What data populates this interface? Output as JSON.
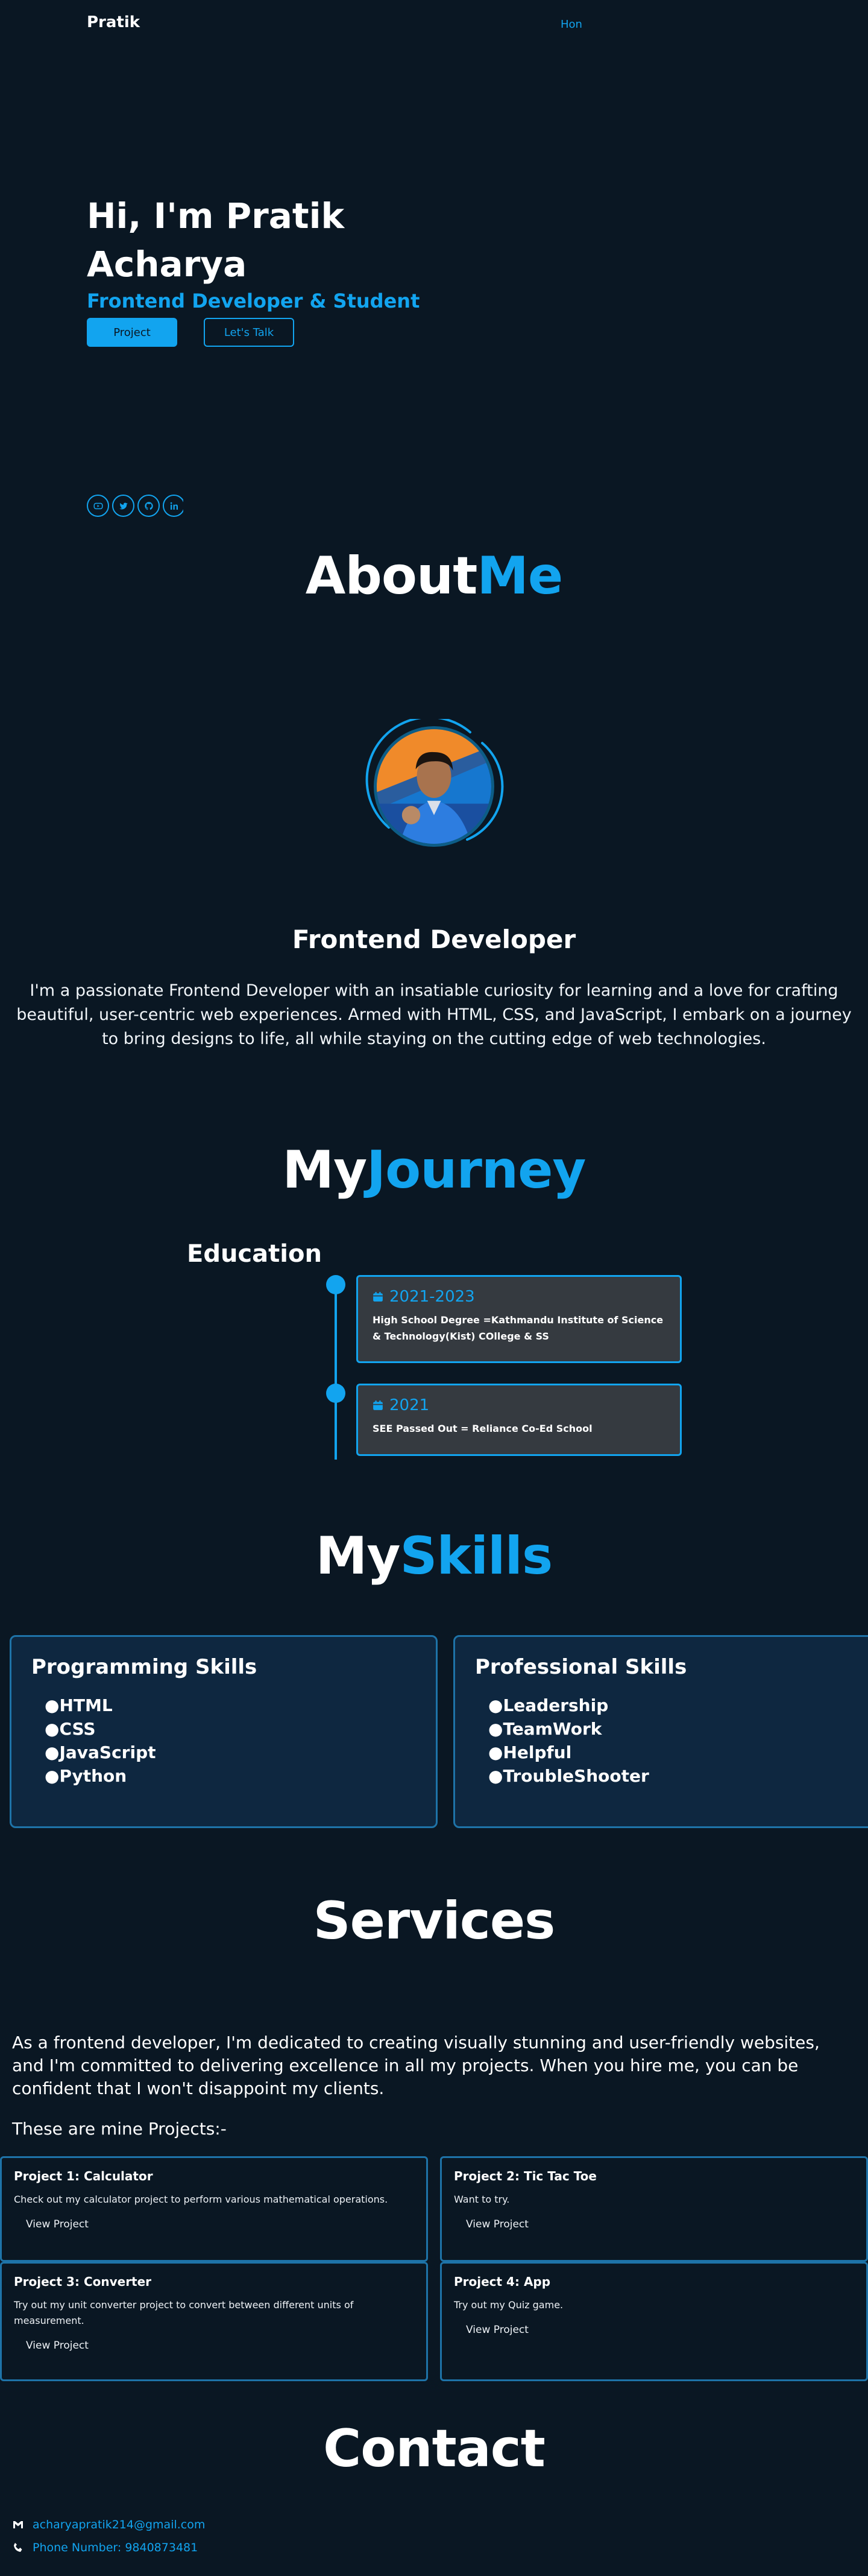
{
  "nav": {
    "brand": "Pratik",
    "link": "Hon"
  },
  "hero": {
    "title": "Hi, I'm Pratik Acharya",
    "subtitle": "Frontend Developer & Student",
    "primary_button": "Project",
    "secondary_button": "Let's Talk",
    "socials": [
      "youtube-icon",
      "twitter-icon",
      "github-icon",
      "linkedin-icon"
    ]
  },
  "about": {
    "title_part1": "About",
    "title_part2": "Me",
    "role": "Frontend Developer",
    "text": "I'm a passionate Frontend Developer with an insatiable curiosity for learning and a love for crafting beautiful, user-centric web experiences. Armed with HTML, CSS, and JavaScript, I embark on a journey to bring designs to life, all while staying on the cutting edge of web technologies."
  },
  "journey": {
    "title_part1": "My",
    "title_part2": "Journey",
    "education_label": "Education",
    "items": [
      {
        "year": "2021-2023",
        "desc": "High School Degree =Kathmandu Institute of Science & Technology(Kist) COllege & SS"
      },
      {
        "year": "2021",
        "desc": "SEE Passed Out = Reliance Co-Ed School"
      }
    ]
  },
  "skills": {
    "title_part1": "My",
    "title_part2": "Skills",
    "cards": [
      {
        "title": "Programming Skills",
        "items": [
          "HTML",
          "CSS",
          "JavaScript",
          "Python"
        ]
      },
      {
        "title": "Professional Skills",
        "items": [
          "Leadership",
          "TeamWork",
          "Helpful",
          "TroubleShooter"
        ]
      }
    ]
  },
  "services": {
    "title": "Services",
    "text": "As a frontend developer, I'm dedicated to creating visually stunning and user-friendly websites, and I'm committed to delivering excellence in all my projects. When you hire me, you can be confident that I won't disappoint my clients.",
    "subtitle": "These are mine Projects:-",
    "projects": [
      {
        "title": "Project 1: Calculator",
        "desc": "Check out my calculator project to perform various mathematical operations.",
        "link": "View Project"
      },
      {
        "title": "Project 2: Tic Tac Toe",
        "desc": "Want to try.",
        "link": "View Project"
      },
      {
        "title": "Project 3: Converter",
        "desc": "Try out my unit converter project to convert between different units of measurement.",
        "link": "View Project"
      },
      {
        "title": "Project 4: App",
        "desc": "Try out my Quiz game.",
        "link": "View Project"
      }
    ]
  },
  "contact": {
    "title": "Contact",
    "email": "acharyapratik214@gmail.com",
    "phone": "Phone Number: 9840873481"
  },
  "colors": {
    "background": "#0a1723",
    "accent": "#12a4ef",
    "card": "#353a40",
    "skill_card": "#0e2740"
  }
}
